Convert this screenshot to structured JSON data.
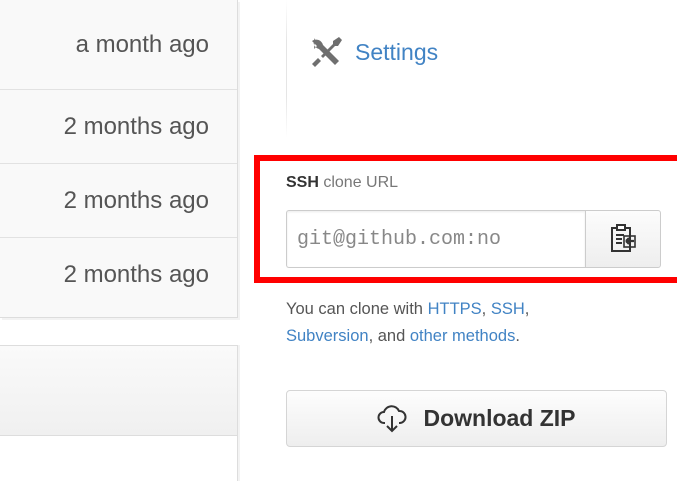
{
  "commits": {
    "rows": [
      {
        "age": "a month ago"
      },
      {
        "age": "2 months ago"
      },
      {
        "age": "2 months ago"
      },
      {
        "age": "2 months ago"
      }
    ]
  },
  "sidebar": {
    "settings": {
      "label": "Settings",
      "icon": "tools-icon"
    }
  },
  "clone": {
    "label_bold": "SSH",
    "label_rest": " clone URL",
    "url_value": "git@github.com:no",
    "copy_icon": "clipboard-icon",
    "help": {
      "prefix": "You can clone with ",
      "https": "HTTPS",
      "sep1": ", ",
      "ssh": "SSH",
      "sep2": ",",
      "subversion": "Subversion",
      "sep3": ", and ",
      "other": "other methods",
      "suffix": "."
    }
  },
  "download": {
    "label": "Download ZIP",
    "icon": "cloud-download-icon"
  },
  "colors": {
    "link": "#4183c4",
    "highlight": "#ff0000"
  }
}
